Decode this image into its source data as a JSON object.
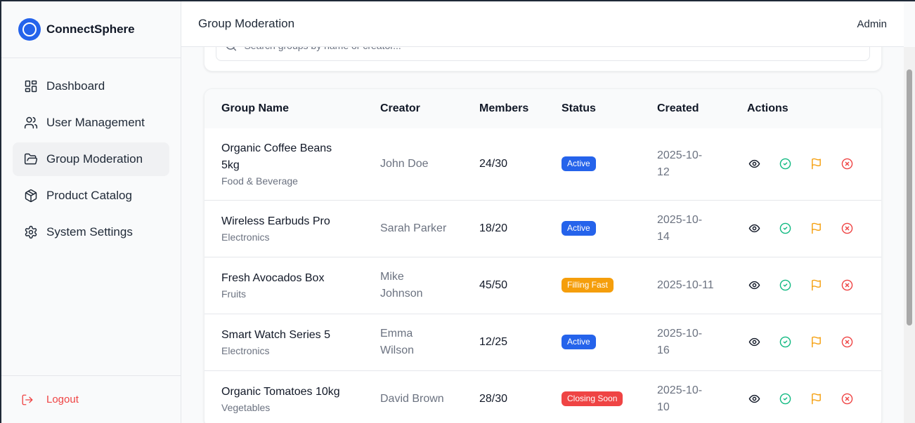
{
  "brand": {
    "name": "ConnectSphere"
  },
  "sidebar": {
    "items": [
      {
        "label": "Dashboard",
        "icon": "dashboard-icon"
      },
      {
        "label": "User Management",
        "icon": "users-icon"
      },
      {
        "label": "Group Moderation",
        "icon": "folder-open-icon",
        "active": true
      },
      {
        "label": "Product Catalog",
        "icon": "package-icon"
      },
      {
        "label": "System Settings",
        "icon": "gear-icon"
      }
    ],
    "logout_label": "Logout"
  },
  "header": {
    "title": "Group Moderation",
    "user": "Admin"
  },
  "search": {
    "placeholder": "Search groups by name or creator..."
  },
  "table": {
    "columns": [
      "Group Name",
      "Creator",
      "Members",
      "Status",
      "Created",
      "Actions"
    ],
    "rows": [
      {
        "name": "Organic Coffee Beans 5kg",
        "category": "Food & Beverage",
        "creator": "John Doe",
        "members": "24/30",
        "status": "Active",
        "created": "2025-10-12"
      },
      {
        "name": "Wireless Earbuds Pro",
        "category": "Electronics",
        "creator": "Sarah Parker",
        "members": "18/20",
        "status": "Active",
        "created": "2025-10-14"
      },
      {
        "name": "Fresh Avocados Box",
        "category": "Fruits",
        "creator": "Mike Johnson",
        "members": "45/50",
        "status": "Filling Fast",
        "created": "2025-10-11"
      },
      {
        "name": "Smart Watch Series 5",
        "category": "Electronics",
        "creator": "Emma Wilson",
        "members": "12/25",
        "status": "Active",
        "created": "2025-10-16"
      },
      {
        "name": "Organic Tomatoes 10kg",
        "category": "Vegetables",
        "creator": "David Brown",
        "members": "28/30",
        "status": "Closing Soon",
        "created": "2025-10-10"
      }
    ]
  },
  "colors": {
    "accent": "#2563eb",
    "status_active": "#2563eb",
    "status_filling_fast": "#f59e0b",
    "status_closing_soon": "#ef4444",
    "approve": "#10b981",
    "flag": "#f59e0b",
    "reject": "#ef4444",
    "logout": "#ef4444"
  }
}
